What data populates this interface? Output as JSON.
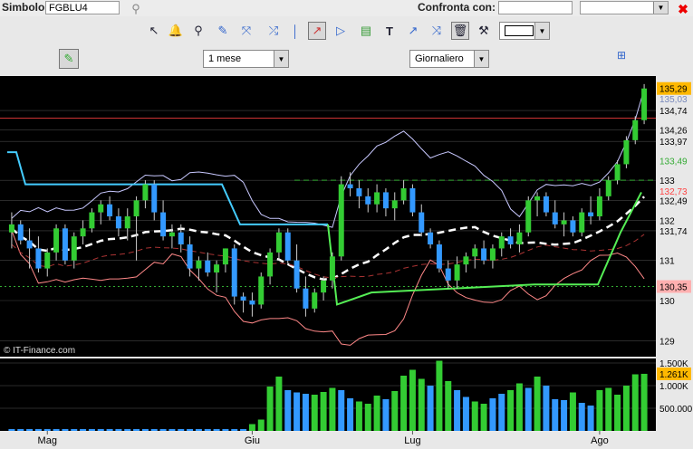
{
  "toolbar": {
    "symbol_label": "Simbolo",
    "symbol_value": "FGBLU4",
    "compare_label": "Confronta con:",
    "compare_value": "",
    "compare_select": ""
  },
  "controls": {
    "period": "1 mese",
    "interval": "Giornaliero"
  },
  "icons": [
    "pointer-icon",
    "alarm-bell-icon",
    "zoom-icon",
    "pencil-icon",
    "line-tool-icon",
    "vertical-line-icon",
    "trendline-icon",
    "fibonacci-fan-icon",
    "indicator-list-icon",
    "text-tool-icon",
    "arrow-tool-icon",
    "multi-line-icon",
    "trash-icon",
    "tools-icon",
    "color-picker-icon"
  ],
  "chart_data": [
    {
      "type": "candlestick",
      "price_labels": [
        "134,74",
        "134,26",
        "133,97",
        "133",
        "132,49",
        "132",
        "131,74",
        "131",
        "130",
        "129"
      ],
      "highlighted_labels": [
        {
          "text": "135,29",
          "bg": "#ffb800",
          "fg": "#000000"
        },
        {
          "text": "135,03",
          "bg": "#000000",
          "fg": "#7788bb"
        },
        {
          "text": "133,49",
          "bg": "#000000",
          "fg": "#33aa33"
        },
        {
          "text": "132,73",
          "bg": "#000000",
          "fg": "#ff4444"
        },
        {
          "text": "130,35",
          "bg": "#ffb0b0",
          "fg": "#000000"
        }
      ],
      "watermark": "© IT-Finance.com",
      "ylim": [
        128.6,
        135.6
      ],
      "red_line": 134.55,
      "green_dash": 133.0,
      "green_dot": 130.35,
      "candles": [
        [
          131.7,
          132.2,
          131.3,
          131.9
        ],
        [
          131.9,
          132.0,
          131.4,
          131.5
        ],
        [
          131.5,
          131.8,
          130.8,
          131.3
        ],
        [
          131.3,
          131.6,
          130.7,
          130.8
        ],
        [
          130.8,
          131.3,
          130.6,
          131.2
        ],
        [
          131.2,
          131.9,
          131.0,
          131.8
        ],
        [
          131.8,
          131.9,
          130.9,
          131.0
        ],
        [
          131.0,
          131.7,
          130.8,
          131.6
        ],
        [
          131.6,
          132.0,
          131.4,
          131.8
        ],
        [
          131.8,
          132.3,
          131.7,
          132.2
        ],
        [
          132.2,
          132.5,
          131.9,
          132.4
        ],
        [
          132.4,
          132.6,
          132.0,
          132.1
        ],
        [
          132.1,
          132.3,
          131.6,
          131.8
        ],
        [
          131.8,
          132.3,
          131.5,
          132.1
        ],
        [
          132.1,
          132.6,
          131.0,
          132.5
        ],
        [
          132.5,
          133.0,
          132.3,
          132.9
        ],
        [
          132.9,
          133.0,
          132.0,
          132.2
        ],
        [
          132.2,
          132.5,
          131.5,
          131.6
        ],
        [
          131.6,
          131.9,
          131.3,
          131.7
        ],
        [
          131.7,
          131.9,
          131.2,
          131.4
        ],
        [
          131.4,
          131.6,
          130.6,
          130.8
        ],
        [
          130.8,
          131.1,
          130.5,
          131.0
        ],
        [
          131.0,
          131.2,
          130.6,
          130.7
        ],
        [
          130.7,
          131.0,
          130.2,
          130.9
        ],
        [
          130.9,
          131.3,
          130.7,
          131.3
        ],
        [
          131.3,
          131.4,
          129.9,
          130.1
        ],
        [
          130.1,
          130.2,
          129.7,
          130.0
        ],
        [
          130.0,
          130.2,
          129.6,
          129.9
        ],
        [
          129.9,
          130.7,
          129.8,
          130.6
        ],
        [
          130.6,
          131.3,
          130.4,
          131.2
        ],
        [
          131.2,
          131.8,
          131.0,
          131.7
        ],
        [
          131.7,
          131.8,
          130.9,
          131.0
        ],
        [
          131.0,
          131.4,
          130.2,
          130.3
        ],
        [
          130.3,
          130.6,
          129.6,
          129.8
        ],
        [
          129.8,
          130.3,
          129.7,
          130.2
        ],
        [
          130.2,
          130.6,
          130.0,
          130.5
        ],
        [
          130.5,
          131.2,
          130.3,
          131.1
        ],
        [
          131.1,
          133.1,
          131.0,
          132.9
        ],
        [
          132.9,
          133.2,
          132.6,
          132.8
        ],
        [
          132.8,
          133.0,
          132.3,
          132.6
        ],
        [
          132.6,
          132.8,
          132.2,
          132.4
        ],
        [
          132.4,
          132.9,
          132.2,
          132.7
        ],
        [
          132.7,
          132.8,
          132.1,
          132.3
        ],
        [
          132.3,
          132.7,
          132.0,
          132.5
        ],
        [
          132.5,
          133.0,
          132.4,
          132.8
        ],
        [
          132.8,
          132.9,
          132.1,
          132.2
        ],
        [
          132.2,
          132.4,
          131.6,
          131.7
        ],
        [
          131.7,
          131.8,
          131.3,
          131.4
        ],
        [
          131.4,
          131.5,
          130.7,
          130.8
        ],
        [
          130.8,
          131.0,
          130.3,
          130.5
        ],
        [
          130.5,
          131.1,
          130.3,
          130.9
        ],
        [
          130.9,
          131.2,
          130.7,
          131.1
        ],
        [
          131.1,
          131.4,
          130.8,
          131.3
        ],
        [
          131.3,
          131.5,
          130.9,
          131.0
        ],
        [
          131.0,
          131.4,
          130.8,
          131.3
        ],
        [
          131.3,
          131.7,
          131.1,
          131.6
        ],
        [
          131.6,
          131.8,
          131.3,
          131.4
        ],
        [
          131.4,
          131.9,
          131.2,
          131.7
        ],
        [
          131.7,
          132.6,
          131.6,
          132.5
        ],
        [
          132.5,
          132.7,
          132.1,
          132.6
        ],
        [
          132.6,
          132.7,
          132.1,
          132.2
        ],
        [
          132.2,
          132.5,
          131.8,
          131.9
        ],
        [
          131.9,
          132.2,
          131.6,
          132.0
        ],
        [
          132.0,
          132.1,
          131.6,
          131.7
        ],
        [
          131.7,
          132.3,
          131.6,
          132.2
        ],
        [
          132.2,
          132.6,
          131.9,
          132.1
        ],
        [
          132.1,
          132.8,
          132.0,
          132.6
        ],
        [
          132.6,
          133.1,
          132.5,
          133.0
        ],
        [
          133.0,
          133.5,
          132.9,
          133.4
        ],
        [
          133.4,
          134.1,
          133.3,
          134.0
        ],
        [
          134.0,
          134.6,
          133.9,
          134.5
        ],
        [
          134.5,
          135.4,
          134.4,
          135.29
        ]
      ]
    },
    {
      "type": "bar",
      "title": "volume",
      "labels": [
        "1.500K",
        "1.000K",
        "500.000"
      ],
      "current_label": "1.261K",
      "ylim": [
        0,
        1600
      ],
      "values": [
        40,
        40,
        40,
        40,
        40,
        40,
        40,
        40,
        40,
        40,
        40,
        40,
        40,
        40,
        40,
        40,
        40,
        40,
        40,
        40,
        40,
        40,
        40,
        40,
        40,
        40,
        40,
        150,
        250,
        980,
        1200,
        900,
        850,
        820,
        800,
        860,
        950,
        900,
        720,
        650,
        600,
        780,
        700,
        880,
        1220,
        1350,
        1150,
        1000,
        1550,
        1100,
        900,
        750,
        650,
        600,
        720,
        820,
        900,
        1050,
        950,
        1200,
        1000,
        700,
        680,
        850,
        620,
        560,
        900,
        950,
        800,
        1000,
        1250,
        1261
      ],
      "colors": [
        "b",
        "b",
        "b",
        "b",
        "b",
        "b",
        "b",
        "b",
        "b",
        "b",
        "b",
        "b",
        "b",
        "b",
        "b",
        "b",
        "b",
        "b",
        "b",
        "b",
        "b",
        "b",
        "b",
        "b",
        "b",
        "b",
        "b",
        "g",
        "g",
        "g",
        "g",
        "b",
        "b",
        "b",
        "g",
        "g",
        "g",
        "b",
        "b",
        "g",
        "g",
        "g",
        "b",
        "g",
        "g",
        "g",
        "g",
        "b",
        "g",
        "g",
        "b",
        "b",
        "g",
        "g",
        "b",
        "b",
        "g",
        "g",
        "b",
        "g",
        "b",
        "b",
        "b",
        "g",
        "b",
        "b",
        "g",
        "g",
        "g",
        "g",
        "g",
        "g"
      ]
    }
  ],
  "x_labels": [
    {
      "t": "Mag",
      "i": 4
    },
    {
      "t": "Giu",
      "i": 27
    },
    {
      "t": "Lug",
      "i": 45
    },
    {
      "t": "Ago",
      "i": 66
    }
  ],
  "colors": {
    "up": "#33cc33",
    "down": "#3399ff",
    "band": "#c8c8ff",
    "lower_band": "#ff8888",
    "signal": "#44ccff",
    "green_signal": "#55ee55"
  }
}
